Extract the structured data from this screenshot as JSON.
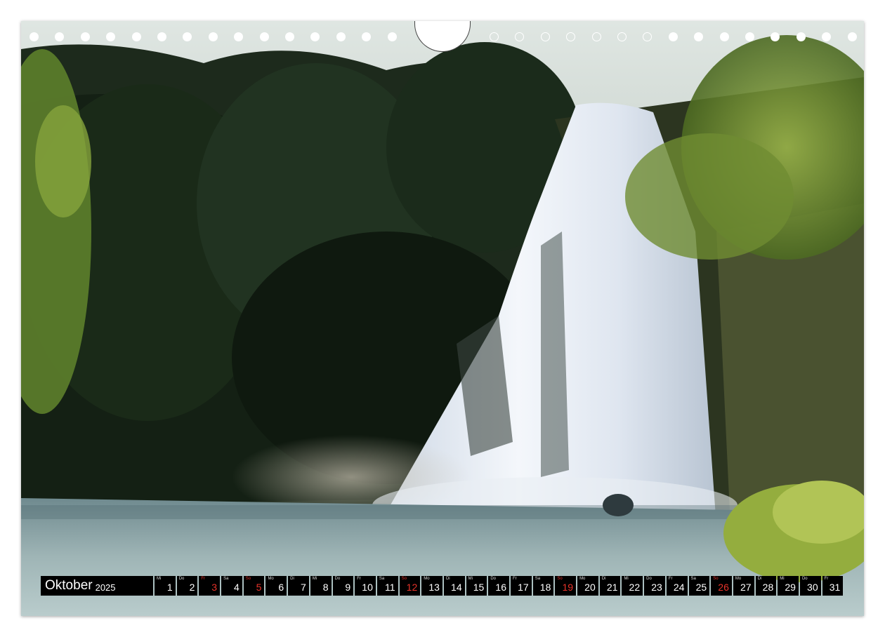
{
  "calendar": {
    "month": "Oktober",
    "year": "2025",
    "days": [
      {
        "wd": "Mi",
        "d": "1",
        "sun": false
      },
      {
        "wd": "Do",
        "d": "2",
        "sun": false
      },
      {
        "wd": "Fr",
        "d": "3",
        "sun": true
      },
      {
        "wd": "Sa",
        "d": "4",
        "sun": false
      },
      {
        "wd": "So",
        "d": "5",
        "sun": true
      },
      {
        "wd": "Mo",
        "d": "6",
        "sun": false
      },
      {
        "wd": "Di",
        "d": "7",
        "sun": false
      },
      {
        "wd": "Mi",
        "d": "8",
        "sun": false
      },
      {
        "wd": "Do",
        "d": "9",
        "sun": false
      },
      {
        "wd": "Fr",
        "d": "10",
        "sun": false
      },
      {
        "wd": "Sa",
        "d": "11",
        "sun": false
      },
      {
        "wd": "So",
        "d": "12",
        "sun": true
      },
      {
        "wd": "Mo",
        "d": "13",
        "sun": false
      },
      {
        "wd": "Di",
        "d": "14",
        "sun": false
      },
      {
        "wd": "Mi",
        "d": "15",
        "sun": false
      },
      {
        "wd": "Do",
        "d": "16",
        "sun": false
      },
      {
        "wd": "Fr",
        "d": "17",
        "sun": false
      },
      {
        "wd": "Sa",
        "d": "18",
        "sun": false
      },
      {
        "wd": "So",
        "d": "19",
        "sun": true
      },
      {
        "wd": "Mo",
        "d": "20",
        "sun": false
      },
      {
        "wd": "Di",
        "d": "21",
        "sun": false
      },
      {
        "wd": "Mi",
        "d": "22",
        "sun": false
      },
      {
        "wd": "Do",
        "d": "23",
        "sun": false
      },
      {
        "wd": "Fr",
        "d": "24",
        "sun": false
      },
      {
        "wd": "Sa",
        "d": "25",
        "sun": false
      },
      {
        "wd": "So",
        "d": "26",
        "sun": true
      },
      {
        "wd": "Mo",
        "d": "27",
        "sun": false
      },
      {
        "wd": "Di",
        "d": "28",
        "sun": false
      },
      {
        "wd": "Mi",
        "d": "29",
        "sun": false
      },
      {
        "wd": "Do",
        "d": "30",
        "sun": false
      },
      {
        "wd": "Fr",
        "d": "31",
        "sun": false
      }
    ]
  },
  "colors": {
    "holiday": "#e8332a",
    "bar": "#000000"
  }
}
